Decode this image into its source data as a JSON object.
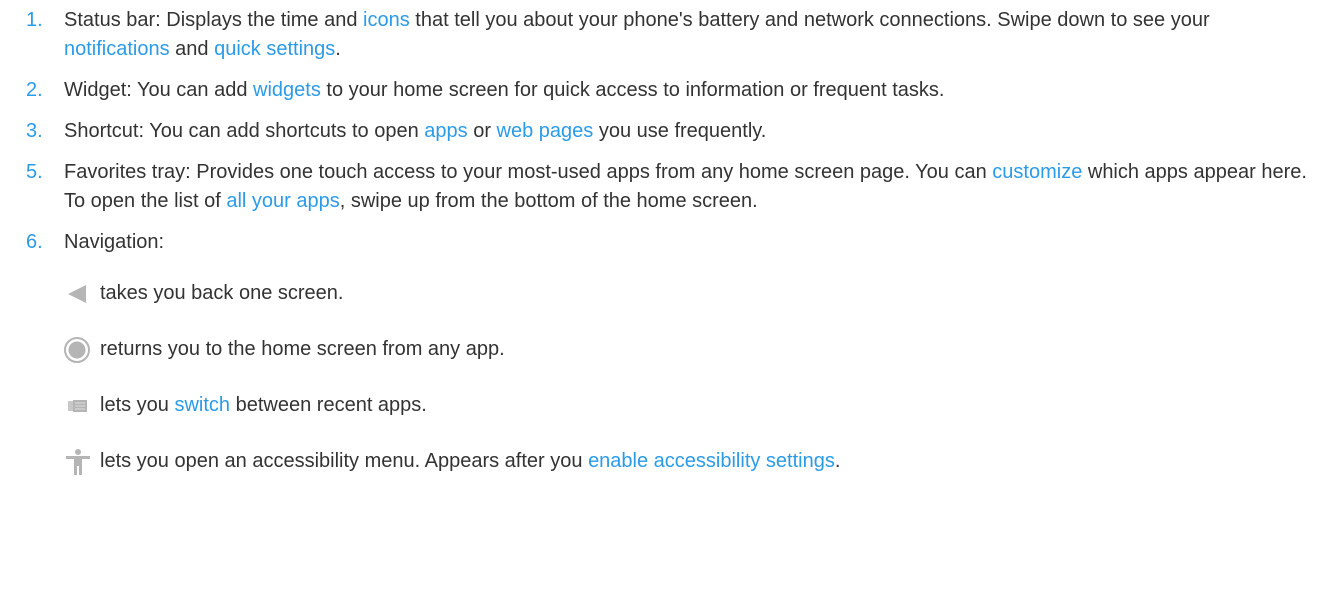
{
  "colors": {
    "text": "#333333",
    "link": "#2b9be8",
    "icon": "#b5b5b5"
  },
  "items": [
    {
      "number": "1.",
      "segments": [
        {
          "text": "Status bar: Displays the time and ",
          "link": false
        },
        {
          "text": "icons",
          "link": true
        },
        {
          "text": " that tell you about your phone's battery and network connections. Swipe down to see your ",
          "link": false
        },
        {
          "text": "notifications",
          "link": true
        },
        {
          "text": " and ",
          "link": false
        },
        {
          "text": "quick settings",
          "link": true
        },
        {
          "text": ".",
          "link": false
        }
      ]
    },
    {
      "number": "2.",
      "segments": [
        {
          "text": "Widget: You can add ",
          "link": false
        },
        {
          "text": "widgets",
          "link": true
        },
        {
          "text": " to your home screen for quick access to information or frequent tasks.",
          "link": false
        }
      ]
    },
    {
      "number": "3.",
      "segments": [
        {
          "text": "Shortcut: You can add shortcuts to open ",
          "link": false
        },
        {
          "text": "apps",
          "link": true
        },
        {
          "text": " or ",
          "link": false
        },
        {
          "text": "web pages",
          "link": true
        },
        {
          "text": " you use frequently.",
          "link": false
        }
      ]
    },
    {
      "number": "5.",
      "segments": [
        {
          "text": "Favorites tray: Provides one touch access to your most-used apps from any home screen page. You can ",
          "link": false
        },
        {
          "text": "customize",
          "link": true
        },
        {
          "text": " which apps appear here. To open the list of ",
          "link": false
        },
        {
          "text": "all your apps",
          "link": true
        },
        {
          "text": ", swipe up from the bottom of the home screen.",
          "link": false
        }
      ]
    },
    {
      "number": "6.",
      "segments": [
        {
          "text": "Navigation:",
          "link": false
        }
      ]
    }
  ],
  "navigation": [
    {
      "icon": "back-triangle-icon",
      "segments": [
        {
          "text": "takes you back one screen.",
          "link": false
        }
      ]
    },
    {
      "icon": "home-circle-icon",
      "segments": [
        {
          "text": "returns you to the home screen from any app.",
          "link": false
        }
      ]
    },
    {
      "icon": "recent-apps-icon",
      "segments": [
        {
          "text": "lets you ",
          "link": false
        },
        {
          "text": "switch",
          "link": true
        },
        {
          "text": " between recent apps.",
          "link": false
        }
      ]
    },
    {
      "icon": "accessibility-icon",
      "segments": [
        {
          "text": "lets you open an accessibility menu. Appears after you ",
          "link": false
        },
        {
          "text": "enable accessibility settings",
          "link": true
        },
        {
          "text": ".",
          "link": false
        }
      ]
    }
  ]
}
